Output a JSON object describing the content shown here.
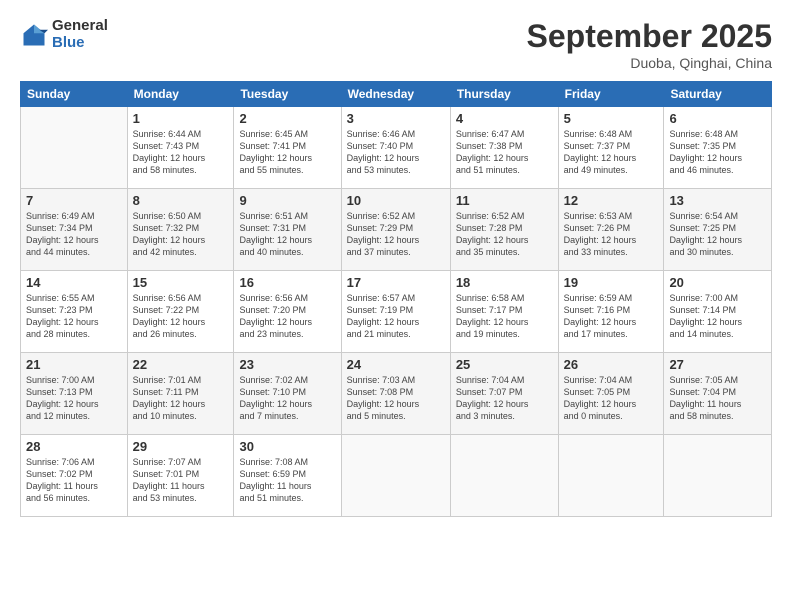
{
  "logo": {
    "general": "General",
    "blue": "Blue"
  },
  "header": {
    "month": "September 2025",
    "location": "Duoba, Qinghai, China"
  },
  "weekdays": [
    "Sunday",
    "Monday",
    "Tuesday",
    "Wednesday",
    "Thursday",
    "Friday",
    "Saturday"
  ],
  "weeks": [
    [
      {
        "day": "",
        "info": ""
      },
      {
        "day": "1",
        "info": "Sunrise: 6:44 AM\nSunset: 7:43 PM\nDaylight: 12 hours\nand 58 minutes."
      },
      {
        "day": "2",
        "info": "Sunrise: 6:45 AM\nSunset: 7:41 PM\nDaylight: 12 hours\nand 55 minutes."
      },
      {
        "day": "3",
        "info": "Sunrise: 6:46 AM\nSunset: 7:40 PM\nDaylight: 12 hours\nand 53 minutes."
      },
      {
        "day": "4",
        "info": "Sunrise: 6:47 AM\nSunset: 7:38 PM\nDaylight: 12 hours\nand 51 minutes."
      },
      {
        "day": "5",
        "info": "Sunrise: 6:48 AM\nSunset: 7:37 PM\nDaylight: 12 hours\nand 49 minutes."
      },
      {
        "day": "6",
        "info": "Sunrise: 6:48 AM\nSunset: 7:35 PM\nDaylight: 12 hours\nand 46 minutes."
      }
    ],
    [
      {
        "day": "7",
        "info": "Sunrise: 6:49 AM\nSunset: 7:34 PM\nDaylight: 12 hours\nand 44 minutes."
      },
      {
        "day": "8",
        "info": "Sunrise: 6:50 AM\nSunset: 7:32 PM\nDaylight: 12 hours\nand 42 minutes."
      },
      {
        "day": "9",
        "info": "Sunrise: 6:51 AM\nSunset: 7:31 PM\nDaylight: 12 hours\nand 40 minutes."
      },
      {
        "day": "10",
        "info": "Sunrise: 6:52 AM\nSunset: 7:29 PM\nDaylight: 12 hours\nand 37 minutes."
      },
      {
        "day": "11",
        "info": "Sunrise: 6:52 AM\nSunset: 7:28 PM\nDaylight: 12 hours\nand 35 minutes."
      },
      {
        "day": "12",
        "info": "Sunrise: 6:53 AM\nSunset: 7:26 PM\nDaylight: 12 hours\nand 33 minutes."
      },
      {
        "day": "13",
        "info": "Sunrise: 6:54 AM\nSunset: 7:25 PM\nDaylight: 12 hours\nand 30 minutes."
      }
    ],
    [
      {
        "day": "14",
        "info": "Sunrise: 6:55 AM\nSunset: 7:23 PM\nDaylight: 12 hours\nand 28 minutes."
      },
      {
        "day": "15",
        "info": "Sunrise: 6:56 AM\nSunset: 7:22 PM\nDaylight: 12 hours\nand 26 minutes."
      },
      {
        "day": "16",
        "info": "Sunrise: 6:56 AM\nSunset: 7:20 PM\nDaylight: 12 hours\nand 23 minutes."
      },
      {
        "day": "17",
        "info": "Sunrise: 6:57 AM\nSunset: 7:19 PM\nDaylight: 12 hours\nand 21 minutes."
      },
      {
        "day": "18",
        "info": "Sunrise: 6:58 AM\nSunset: 7:17 PM\nDaylight: 12 hours\nand 19 minutes."
      },
      {
        "day": "19",
        "info": "Sunrise: 6:59 AM\nSunset: 7:16 PM\nDaylight: 12 hours\nand 17 minutes."
      },
      {
        "day": "20",
        "info": "Sunrise: 7:00 AM\nSunset: 7:14 PM\nDaylight: 12 hours\nand 14 minutes."
      }
    ],
    [
      {
        "day": "21",
        "info": "Sunrise: 7:00 AM\nSunset: 7:13 PM\nDaylight: 12 hours\nand 12 minutes."
      },
      {
        "day": "22",
        "info": "Sunrise: 7:01 AM\nSunset: 7:11 PM\nDaylight: 12 hours\nand 10 minutes."
      },
      {
        "day": "23",
        "info": "Sunrise: 7:02 AM\nSunset: 7:10 PM\nDaylight: 12 hours\nand 7 minutes."
      },
      {
        "day": "24",
        "info": "Sunrise: 7:03 AM\nSunset: 7:08 PM\nDaylight: 12 hours\nand 5 minutes."
      },
      {
        "day": "25",
        "info": "Sunrise: 7:04 AM\nSunset: 7:07 PM\nDaylight: 12 hours\nand 3 minutes."
      },
      {
        "day": "26",
        "info": "Sunrise: 7:04 AM\nSunset: 7:05 PM\nDaylight: 12 hours\nand 0 minutes."
      },
      {
        "day": "27",
        "info": "Sunrise: 7:05 AM\nSunset: 7:04 PM\nDaylight: 11 hours\nand 58 minutes."
      }
    ],
    [
      {
        "day": "28",
        "info": "Sunrise: 7:06 AM\nSunset: 7:02 PM\nDaylight: 11 hours\nand 56 minutes."
      },
      {
        "day": "29",
        "info": "Sunrise: 7:07 AM\nSunset: 7:01 PM\nDaylight: 11 hours\nand 53 minutes."
      },
      {
        "day": "30",
        "info": "Sunrise: 7:08 AM\nSunset: 6:59 PM\nDaylight: 11 hours\nand 51 minutes."
      },
      {
        "day": "",
        "info": ""
      },
      {
        "day": "",
        "info": ""
      },
      {
        "day": "",
        "info": ""
      },
      {
        "day": "",
        "info": ""
      }
    ]
  ]
}
